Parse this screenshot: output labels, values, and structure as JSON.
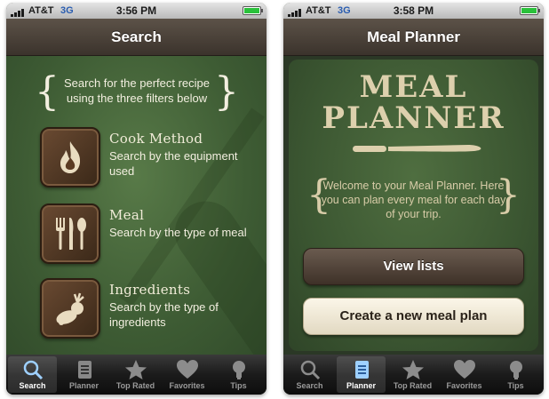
{
  "status_left": {
    "carrier": "AT&T",
    "network": "3G",
    "time": "3:56 PM"
  },
  "status_right": {
    "carrier": "AT&T",
    "network": "3G",
    "time": "3:58 PM"
  },
  "search_screen": {
    "title": "Search",
    "intro": "Search for the perfect recipe using the three filters below",
    "filters": [
      {
        "title": "Cook Method",
        "desc": "Search by the equipment used",
        "icon": "flame-icon"
      },
      {
        "title": "Meal",
        "desc": "Search by the type of meal",
        "icon": "utensils-icon"
      },
      {
        "title": "Ingredients",
        "desc": "Search by the type of ingredients",
        "icon": "vegetables-icon"
      }
    ]
  },
  "planner_screen": {
    "title": "Meal Planner",
    "logo_line1": "MEAL",
    "logo_line2": "PLANNER",
    "welcome": "Welcome to your Meal Planner. Here you can plan every meal for each day of your trip.",
    "view_lists_label": "View lists",
    "create_plan_label": "Create a new meal plan"
  },
  "tabs": [
    {
      "label": "Search",
      "icon": "magnifier-icon"
    },
    {
      "label": "Planner",
      "icon": "notebook-icon"
    },
    {
      "label": "Top Rated",
      "icon": "star-icon"
    },
    {
      "label": "Favorites",
      "icon": "heart-icon"
    },
    {
      "label": "Tips",
      "icon": "lightbulb-icon"
    }
  ],
  "colors": {
    "green_bg": "#3e5c34",
    "navbar_brown": "#4a4139",
    "cream_text": "#f3efe0",
    "logo_tan": "#ddd0ad",
    "network_blue": "#2a5db0"
  }
}
